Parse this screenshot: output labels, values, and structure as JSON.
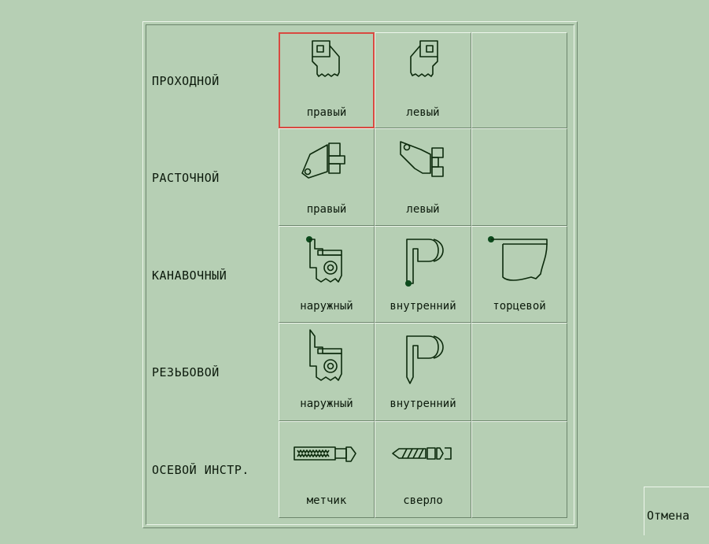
{
  "rows": [
    {
      "label": "ПРОХОДНОЙ",
      "tools": [
        "правый",
        "левый",
        ""
      ]
    },
    {
      "label": "РАСТОЧНОЙ",
      "tools": [
        "правый",
        "левый",
        ""
      ]
    },
    {
      "label": "КАНАВОЧНЫЙ",
      "tools": [
        "наружный",
        "внутренний",
        "торцевой"
      ]
    },
    {
      "label": "РЕЗЬБОВОЙ",
      "tools": [
        "наружный",
        "внутренний",
        ""
      ]
    },
    {
      "label": "ОСЕВОЙ ИНСТР.",
      "tools": [
        "метчик",
        "сверло",
        ""
      ]
    }
  ],
  "cancel_label": "Отмена",
  "selected": "passing-right",
  "colors": {
    "background": "#b6cfb4",
    "selection": "#d84a40",
    "icon_stroke": "#0c2a0c"
  }
}
